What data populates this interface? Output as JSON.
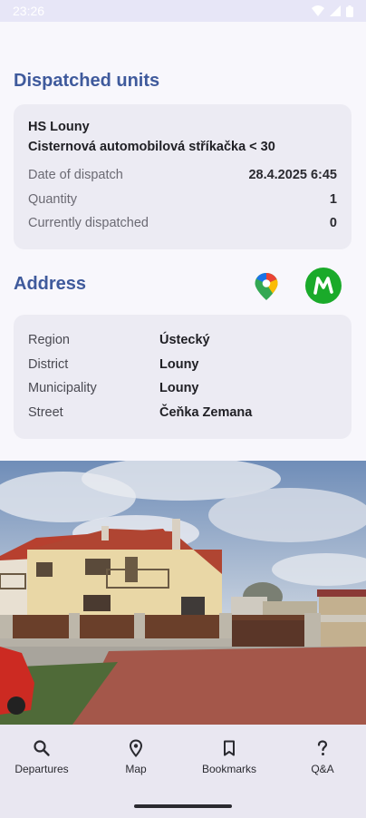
{
  "status_bar": {
    "time": "23:26"
  },
  "dispatched": {
    "title": "Dispatched units",
    "unit_station": "HS Louny",
    "unit_vehicle": "Cisternová automobilová stříkačka < 30",
    "rows": [
      {
        "label": "Date of dispatch",
        "value": "28.4.2025 6:45"
      },
      {
        "label": "Quantity",
        "value": "1"
      },
      {
        "label": "Currently dispatched",
        "value": "0"
      }
    ]
  },
  "address": {
    "title": "Address",
    "rows": [
      {
        "label": "Region",
        "value": "Ústecký"
      },
      {
        "label": "District",
        "value": "Louny"
      },
      {
        "label": "Municipality",
        "value": "Louny"
      },
      {
        "label": "Street",
        "value": "Čeňka Zemana"
      }
    ]
  },
  "nav": {
    "items": [
      {
        "label": "Departures",
        "icon": "search-icon"
      },
      {
        "label": "Map",
        "icon": "map-pin-icon"
      },
      {
        "label": "Bookmarks",
        "icon": "bookmark-icon"
      },
      {
        "label": "Q&A",
        "icon": "question-icon"
      }
    ]
  },
  "colors": {
    "accent": "#3f5a9c",
    "mapy_green": "#1aaa2a"
  }
}
